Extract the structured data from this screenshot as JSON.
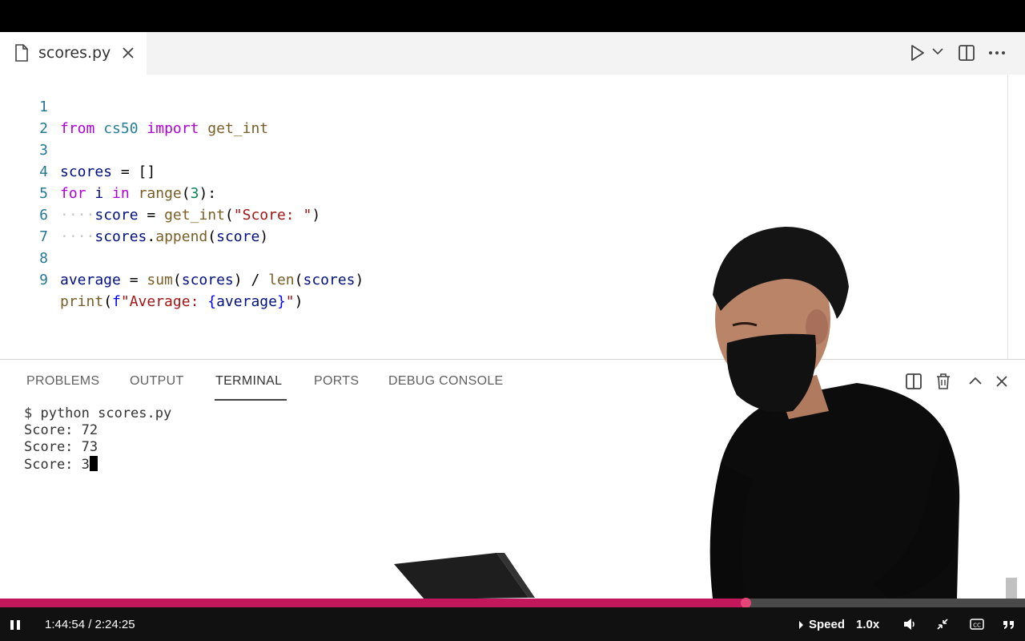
{
  "tab": {
    "filename": "scores.py"
  },
  "code_lines": [
    {
      "num": "1"
    },
    {
      "num": "2"
    },
    {
      "num": "3"
    },
    {
      "num": "4"
    },
    {
      "num": "5"
    },
    {
      "num": "6"
    },
    {
      "num": "7"
    },
    {
      "num": "8"
    },
    {
      "num": "9"
    }
  ],
  "panel": {
    "tabs": [
      "PROBLEMS",
      "OUTPUT",
      "TERMINAL",
      "PORTS",
      "DEBUG CONSOLE"
    ],
    "active_tab": "TERMINAL"
  },
  "terminal": {
    "lines": [
      "$ python scores.py",
      "Score: 72",
      "Score: 73",
      "Score: 3"
    ]
  },
  "player": {
    "time": "1:44:54 / 2:24:25",
    "speed_label": "Speed",
    "speed_value": "1.0x",
    "progress": 0.727
  },
  "colors": {
    "progress_fill": "#c2185b",
    "line_number": "#237893"
  },
  "icons": {
    "file": "file-icon",
    "close": "close-icon",
    "run": "play-icon",
    "split": "split-editor-icon",
    "more": "more-icon",
    "trash": "trash-icon",
    "maximize": "chevron-up-icon",
    "pause": "pause-icon",
    "volume": "volume-icon",
    "exit_fullscreen": "exit-fullscreen-icon",
    "captions": "cc-icon",
    "quote": "quote-icon"
  }
}
